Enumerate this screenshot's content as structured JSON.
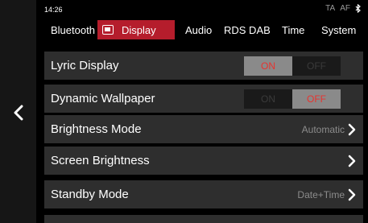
{
  "status": {
    "time": "14:26",
    "ta": "TA",
    "af": "AF",
    "bluetooth_icon": "bluetooth-icon"
  },
  "tabs": [
    {
      "label": "Bluetooth"
    },
    {
      "label": "Display",
      "icon": "display-icon",
      "active": true
    },
    {
      "label": "Audio"
    },
    {
      "label": "RDS DAB"
    },
    {
      "label": "Time"
    },
    {
      "label": "System"
    }
  ],
  "settings": {
    "lyric_display": {
      "label": "Lyric Display",
      "on": "ON",
      "off": "OFF",
      "state": "on"
    },
    "dynamic_wallpaper": {
      "label": "Dynamic Wallpaper",
      "on": "ON",
      "off": "OFF",
      "state": "off"
    },
    "brightness_mode": {
      "label": "Brightness Mode",
      "value": "Automatic"
    },
    "screen_brightness": {
      "label": "Screen Brightness"
    },
    "standby_mode": {
      "label": "Standby Mode",
      "value": "Date+Time"
    }
  },
  "colors": {
    "accent": "#b51d2c",
    "active_text": "#e8332f",
    "row_bg": "#2e2e2e"
  }
}
